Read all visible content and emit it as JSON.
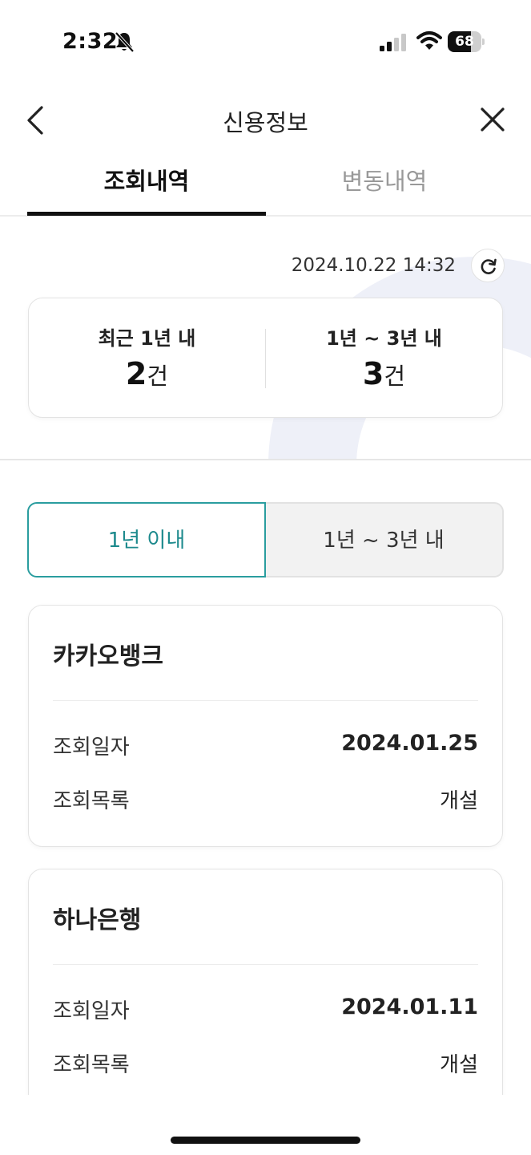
{
  "status_bar": {
    "time": "2:32",
    "battery_level": "68",
    "battery_fraction": 0.68
  },
  "header": {
    "title": "신용정보",
    "back_icon": "chevron-left-icon",
    "close_icon": "close-icon"
  },
  "tabs": [
    {
      "label": "조회내역",
      "active": true
    },
    {
      "label": "변동내역",
      "active": false
    }
  ],
  "summary": {
    "timestamp": "2024.10.22 14:32",
    "refresh_icon": "refresh-icon",
    "items": [
      {
        "label": "최근 1년 내",
        "count": "2",
        "unit": "건"
      },
      {
        "label": "1년 ~ 3년 내",
        "count": "3",
        "unit": "건"
      }
    ]
  },
  "segments": [
    {
      "label": "1년 이내",
      "active": true
    },
    {
      "label": "1년 ~ 3년 내",
      "active": false
    }
  ],
  "records": [
    {
      "institution": "카카오뱅크",
      "date_label": "조회일자",
      "date": "2024.01.25",
      "purpose_label": "조회목록",
      "purpose": "개설"
    },
    {
      "institution": "하나은행",
      "date_label": "조회일자",
      "date": "2024.01.11",
      "purpose_label": "조회목록",
      "purpose": "개설"
    }
  ],
  "colors": {
    "accent": "#2a9d9f",
    "accent_text": "#1d8a8d",
    "active_tab_underline": "#111111",
    "segment_inactive_bg": "#f2f2f2",
    "decoration": "#eef0f8"
  }
}
